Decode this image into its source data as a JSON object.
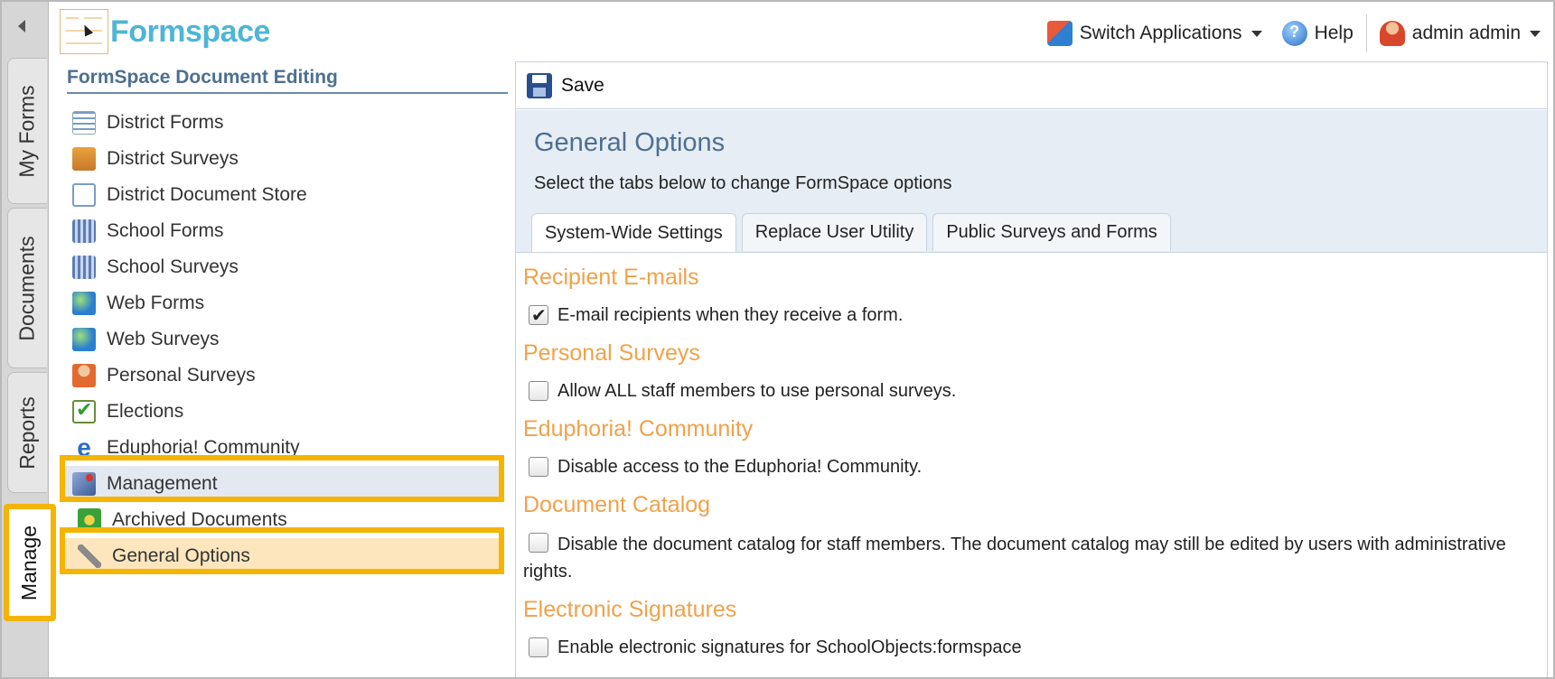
{
  "rail": {
    "tabs": [
      {
        "label": "My Forms"
      },
      {
        "label": "Documents"
      },
      {
        "label": "Reports"
      },
      {
        "label": "Manage"
      }
    ]
  },
  "header": {
    "logo_text": "Formspace",
    "switch_apps": "Switch Applications",
    "help": "Help",
    "user": "admin admin"
  },
  "nav": {
    "title": "FormSpace Document Editing",
    "items": [
      {
        "label": "District Forms",
        "icon": "form-list-icon"
      },
      {
        "label": "District Surveys",
        "icon": "clipboard-icon"
      },
      {
        "label": "District Document Store",
        "icon": "document-icon"
      },
      {
        "label": "School Forms",
        "icon": "building-icon"
      },
      {
        "label": "School Surveys",
        "icon": "building-survey-icon"
      },
      {
        "label": "Web Forms",
        "icon": "globe-icon"
      },
      {
        "label": "Web Surveys",
        "icon": "globe-survey-icon"
      },
      {
        "label": "Personal Surveys",
        "icon": "person-icon"
      },
      {
        "label": "Elections",
        "icon": "checkmark-icon"
      },
      {
        "label": "Eduphoria! Community",
        "icon": "eduphoria-icon"
      },
      {
        "label": "Management",
        "icon": "management-icon"
      },
      {
        "label": "Archived Documents",
        "icon": "archive-icon"
      },
      {
        "label": "General Options",
        "icon": "wrench-icon"
      }
    ]
  },
  "toolbar": {
    "save_label": "Save"
  },
  "main": {
    "title": "General Options",
    "subtitle": "Select the tabs below to change FormSpace options",
    "tabs": [
      {
        "label": "System-Wide Settings",
        "active": true
      },
      {
        "label": "Replace User Utility",
        "active": false
      },
      {
        "label": "Public Surveys and Forms",
        "active": false
      }
    ],
    "sections": [
      {
        "title": "Recipient E-mails",
        "option": "E-mail recipients when they receive a form.",
        "checked": true
      },
      {
        "title": "Personal Surveys",
        "option": "Allow ALL staff members to use personal surveys.",
        "checked": false
      },
      {
        "title": "Eduphoria! Community",
        "option": "Disable access to the Eduphoria! Community.",
        "checked": false
      },
      {
        "title": "Document Catalog",
        "option": "Disable the document catalog for staff members. The document catalog may still be edited by users with administrative rights.",
        "checked": false
      },
      {
        "title": "Electronic Signatures",
        "option": "Enable electronic signatures for SchoolObjects:formspace",
        "checked": false
      }
    ]
  },
  "colors": {
    "section_title": "#f0a24a",
    "highlight": "#f5b400",
    "nav_title": "#4e6f91",
    "logo": "#4fb5d6"
  }
}
